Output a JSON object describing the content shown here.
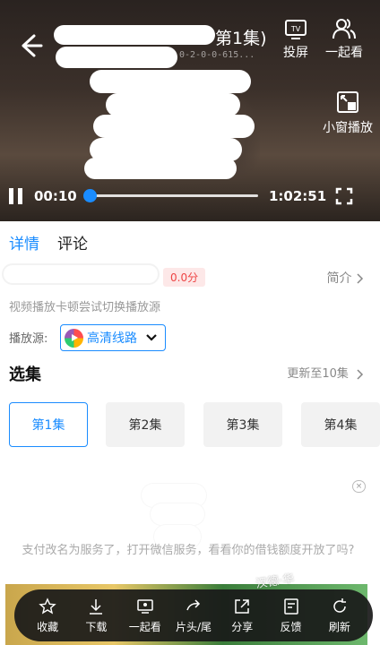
{
  "player": {
    "title": "第1集)",
    "subtitle": "0-2-0-0-615...",
    "actions": [
      {
        "label": "投屏",
        "icon": "tv-cast-icon"
      },
      {
        "label": "一起看",
        "icon": "people-icon"
      }
    ],
    "pip": {
      "label": "小窗播放",
      "icon": "picture-in-picture-icon"
    },
    "current_time": "00:10",
    "total_time": "1:02:51",
    "progress": 0.003
  },
  "tabs": [
    {
      "label": "详情",
      "active": true
    },
    {
      "label": "评论",
      "active": false
    }
  ],
  "detail": {
    "score": "0.0分",
    "intro": "简介",
    "tip": "视频播放卡顿尝试切换播放源",
    "source_label": "播放源:",
    "source_value": "高清线路"
  },
  "episodes": {
    "heading": "选集",
    "update_info": "更新至10集",
    "items": [
      "第1集",
      "第2集",
      "第3集",
      "第4集"
    ],
    "selected": "第1集"
  },
  "ad": {
    "close": "×",
    "text": "支付改名为服务了，打开微信服务，看看你的借钱额度开放了吗?",
    "watermark": "汉德·华"
  },
  "bottom_bar": [
    {
      "label": "收藏",
      "icon": "star-icon"
    },
    {
      "label": "下载",
      "icon": "download-icon"
    },
    {
      "label": "一起看",
      "icon": "watch-together-icon"
    },
    {
      "label": "片头/尾",
      "icon": "skip-icon"
    },
    {
      "label": "分享",
      "icon": "share-icon"
    },
    {
      "label": "反馈",
      "icon": "feedback-icon"
    },
    {
      "label": "刷新",
      "icon": "refresh-icon"
    }
  ]
}
